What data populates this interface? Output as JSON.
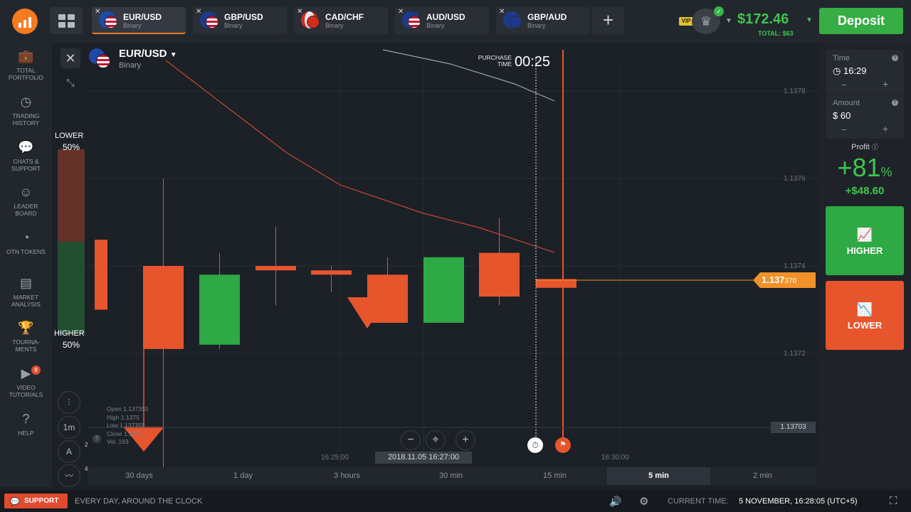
{
  "brand": {
    "logo": "bar-chart-logo"
  },
  "tabs": [
    {
      "name": "EUR/USD",
      "type": "Binary",
      "active": true
    },
    {
      "name": "GBP/USD",
      "type": "Binary",
      "active": false
    },
    {
      "name": "CAD/CHF",
      "type": "Binary",
      "active": false
    },
    {
      "name": "AUD/USD",
      "type": "Binary",
      "active": false
    },
    {
      "name": "GBP/AUD",
      "type": "Binary",
      "active": false
    }
  ],
  "add_tab": "+",
  "account": {
    "vip": "VIP",
    "balance": "$172.46",
    "total": "TOTAL: $63",
    "deposit": "Deposit"
  },
  "sidebar": [
    {
      "label": "TOTAL PORTFOLIO",
      "icon": "briefcase-icon"
    },
    {
      "label": "TRADING HISTORY",
      "icon": "clock-history-icon"
    },
    {
      "label": "CHATS & SUPPORT",
      "icon": "chat-icon"
    },
    {
      "label": "LEADER BOARD",
      "icon": "leaderboard-icon"
    },
    {
      "label": "OTN TOKENS",
      "icon": "token-icon"
    },
    {
      "label": "MARKET ANALYSIS",
      "icon": "analysis-icon"
    },
    {
      "label": "TOURNA-MENTS",
      "icon": "trophy-icon"
    },
    {
      "label": "VIDEO TUTORIALS",
      "icon": "play-icon",
      "badge": "8"
    },
    {
      "label": "HELP",
      "icon": "help-icon"
    }
  ],
  "chart": {
    "asset": "EUR/USD",
    "asset_type": "Binary",
    "purchase_label_1": "PURCHASE",
    "purchase_label_2": "TIME",
    "purchase_time": "00:25",
    "lower_label": "LOWER",
    "lower_pct": "50%",
    "higher_label": "HIGHER",
    "higher_pct": "50%",
    "price_labels": [
      "1.1378",
      "1.1376",
      "1.1374",
      "1.1372"
    ],
    "current_price_main": "1.137",
    "current_price_tail": "370",
    "crosshair_price": "1.13703",
    "ohlc": {
      "open": "Open  1.137355",
      "high": "High   1.1375",
      "low": "Low   1.137355",
      "close": "Close  1.1375",
      "vol": "Vol.     193"
    },
    "date_label": "2018.11.05 16:27:00",
    "time_labels": [
      "16:25:00",
      "16:30:00"
    ],
    "chart_timeframe": "1m",
    "tool_badges": [
      "2",
      "4"
    ],
    "zoom_plus": "+"
  },
  "periods": [
    {
      "label": "30 days",
      "active": false
    },
    {
      "label": "1 day",
      "active": false
    },
    {
      "label": "3 hours",
      "active": false
    },
    {
      "label": "30 min",
      "active": false
    },
    {
      "label": "15 min",
      "active": false
    },
    {
      "label": "5 min",
      "active": true
    },
    {
      "label": "2 min",
      "active": false
    }
  ],
  "right_panel": {
    "time_label": "Time",
    "time_value": "16:29",
    "amount_label": "Amount",
    "amount_value": "$ 60",
    "minus": "−",
    "plus": "+",
    "profit_label": "Profit",
    "profit_pct": "+81",
    "profit_pct_sign": "%",
    "profit_amount": "+$48.60",
    "higher": "HIGHER",
    "lower": "LOWER"
  },
  "bottom": {
    "support": "SUPPORT",
    "support_text": "EVERY DAY, AROUND THE CLOCK",
    "current_time_label": "CURRENT TIME:",
    "current_time_value": "5 NOVEMBER, 16:28:05 (UTC+5)"
  },
  "colors": {
    "up": "#2fa944",
    "down": "#e7552d",
    "accent": "#f47b20",
    "balance": "#3ec64f"
  },
  "candles": [
    {
      "open": 1.13746,
      "close": 1.1373,
      "high": 1.13738,
      "low": 1.13737
    },
    {
      "open": 1.1374,
      "close": 1.13721,
      "high": 1.1376,
      "low": 1.13694
    },
    {
      "open": 1.13722,
      "close": 1.13738,
      "high": 1.13743,
      "low": 1.13721
    },
    {
      "open": 1.1374,
      "close": 1.13739,
      "high": 1.13749,
      "low": 1.13731
    },
    {
      "open": 1.13739,
      "close": 1.13738,
      "high": 1.1374,
      "low": 1.13734
    },
    {
      "open": 1.13738,
      "close": 1.13727,
      "high": 1.13742,
      "low": 1.13727
    },
    {
      "open": 1.13727,
      "close": 1.13742,
      "high": 1.13742,
      "low": 1.13727
    },
    {
      "open": 1.13743,
      "close": 1.13733,
      "high": 1.13751,
      "low": 1.13731
    },
    {
      "open": 1.13737,
      "close": 1.13735,
      "high": 1.13737,
      "low": 1.13735
    }
  ]
}
